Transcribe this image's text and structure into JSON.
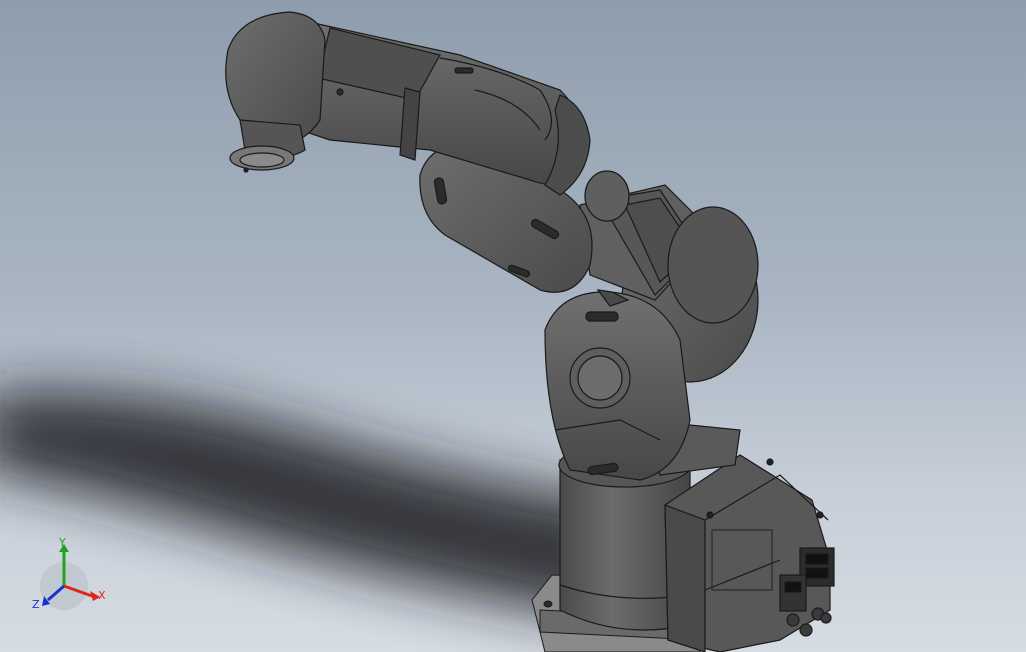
{
  "viewport": {
    "model": "six-axis-robot-arm-model"
  },
  "triad": {
    "x_label": "X",
    "y_label": "Y",
    "z_label": "Z",
    "x_color": "#e0241b",
    "y_color": "#1fa31f",
    "z_color": "#1a2fd0"
  },
  "colors": {
    "body": "#5c5c5c",
    "body_dark": "#3e3e3e",
    "body_light": "#7a7a7a",
    "edge": "#1a1a1a",
    "shadow": "#1c1f24"
  }
}
